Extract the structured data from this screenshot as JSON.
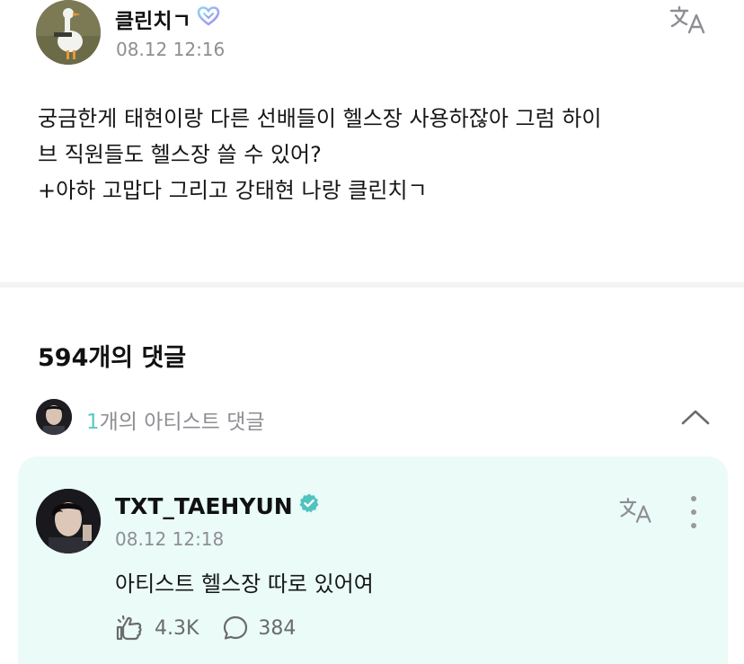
{
  "post": {
    "author": "클린치ㄱ",
    "time": "08.12 12:16",
    "body_lines": [
      "궁금한게 태현이랑 다른 선배들이 헬스장 사용하잖아 그럼 하이",
      "브 직원들도 헬스장 쓸 수 있어?",
      "+아하 고맙다 그리고 강태현 나랑 클린치ㄱ"
    ]
  },
  "comments": {
    "count_label": "594개의 댓글",
    "artist_summary": {
      "count": "1",
      "label": "개의 아티스트 댓글"
    }
  },
  "artist_comment": {
    "author": "TXT_TAEHYUN",
    "time": "08.12 12:18",
    "text": "아티스트 헬스장 따로 있어여",
    "likes": "4.3K",
    "replies": "384"
  },
  "colors": {
    "accent": "#5bc8c4",
    "card_bg": "#eafbf8",
    "muted_text": "#8e8e93",
    "verified": "#4fc3c0"
  },
  "icons": {
    "membership": "heart-badge-icon",
    "translate": "translate-icon",
    "collapse": "chevron-up-icon",
    "verified": "verified-badge-icon",
    "more": "more-vertical-icon",
    "cheer": "cheer-hand-icon",
    "reply": "comment-bubble-icon"
  }
}
